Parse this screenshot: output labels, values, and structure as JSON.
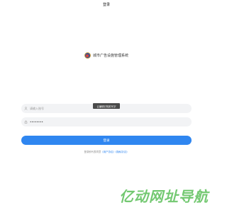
{
  "header": {
    "title": "登录"
  },
  "brand": {
    "name": "城市广告设施管理系统"
  },
  "tooltip": {
    "text": "云编辑已知前写字"
  },
  "form": {
    "username_placeholder": "请输入账号",
    "password_value": "••••••••"
  },
  "login_button": {
    "label": "登录"
  },
  "agreement": {
    "prefix": "登录即代表同意",
    "user_agreement": "《用户协议》",
    "privacy_policy": "《隐私协议》"
  },
  "watermark": {
    "text": "亿动网址导航"
  },
  "colors": {
    "primary": "#2f86f0",
    "input_bg": "#f2f3f5",
    "tooltip_bg": "#4a4a4a",
    "watermark": "#6cc66a"
  }
}
